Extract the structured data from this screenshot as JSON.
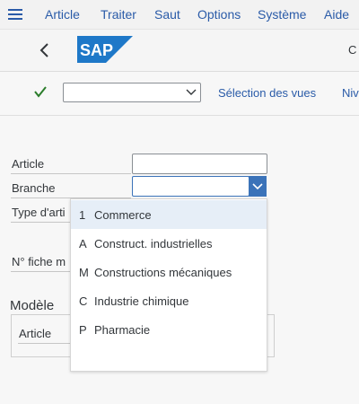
{
  "menubar": {
    "items": [
      "Article",
      "Traiter",
      "Saut",
      "Options",
      "Système",
      "Aide"
    ]
  },
  "titlebar": {
    "logo": "SAP",
    "title_fragment": "C"
  },
  "toolbar": {
    "combo_value": "",
    "links": [
      "Sélection des vues",
      "Niv"
    ]
  },
  "form": {
    "article_label": "Article",
    "article_value": "",
    "branche_label": "Branche",
    "branche_value": "",
    "type_label": "Type d'arti",
    "fiche_label": "N° fiche m",
    "modele_title": "Modèle",
    "modele_article_label": "Article"
  },
  "dropdown": {
    "items": [
      {
        "key": "1",
        "text": "Commerce",
        "selected": true
      },
      {
        "key": "A",
        "text": "Construct. industrielles",
        "selected": false
      },
      {
        "key": "M",
        "text": "Constructions mécaniques",
        "selected": false
      },
      {
        "key": "C",
        "text": "Industrie chimique",
        "selected": false
      },
      {
        "key": "P",
        "text": "Pharmacie",
        "selected": false
      }
    ]
  },
  "colors": {
    "accent": "#2a5ba8",
    "logo_blue": "#1e78c8",
    "check_green": "#2b7d2b",
    "selected_row": "#e6eef7"
  }
}
